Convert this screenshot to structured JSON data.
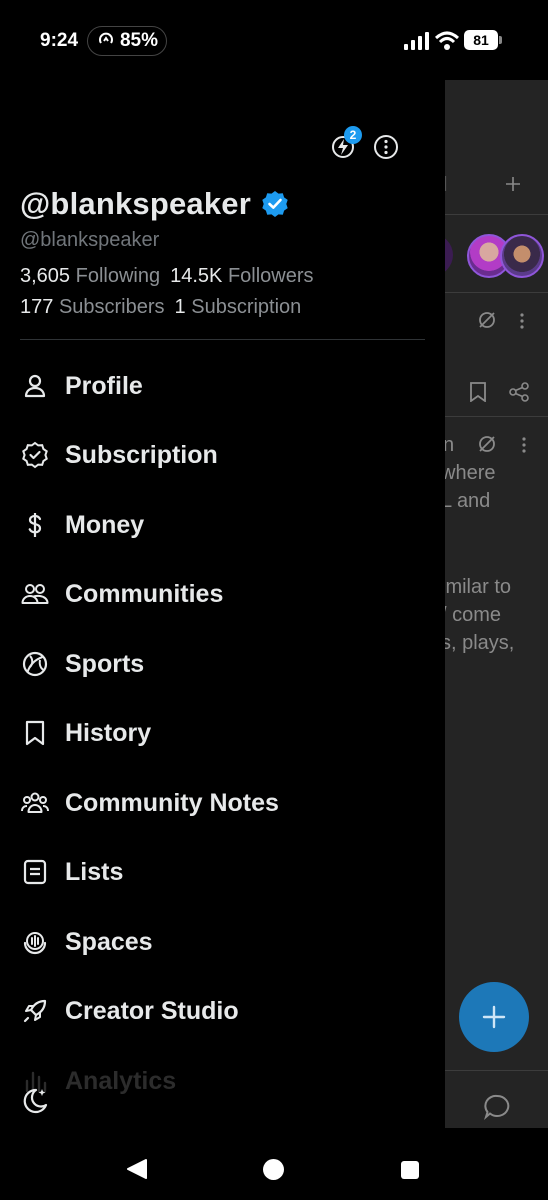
{
  "status_bar": {
    "time": "9:24",
    "hotspot_percent": "85%",
    "battery": "81",
    "icons": [
      "hotspot-icon",
      "signal-icon",
      "wifi-icon",
      "battery-icon"
    ]
  },
  "drawer": {
    "notification_badge": "2",
    "display_name": "@blankspeaker",
    "username": "@blankspeaker",
    "stats": {
      "following_count": "3,605",
      "following_label": "Following",
      "followers_count": "14.5K",
      "followers_label": "Followers",
      "subscribers_count": "177",
      "subscribers_label": "Subscribers",
      "subscription_count": "1",
      "subscription_label": "Subscription"
    },
    "menu": [
      {
        "label": "Profile",
        "icon": "person-icon"
      },
      {
        "label": "Subscription",
        "icon": "verified-badge-icon"
      },
      {
        "label": "Money",
        "icon": "dollar-icon"
      },
      {
        "label": "Communities",
        "icon": "people-icon"
      },
      {
        "label": "Sports",
        "icon": "ball-icon"
      },
      {
        "label": "History",
        "icon": "bookmark-icon"
      },
      {
        "label": "Community Notes",
        "icon": "group-icon"
      },
      {
        "label": "Lists",
        "icon": "list-icon"
      },
      {
        "label": "Spaces",
        "icon": "mic-icon"
      },
      {
        "label": "Creator Studio",
        "icon": "rocket-icon"
      },
      {
        "label": "Analytics",
        "icon": "bar-chart-icon"
      }
    ]
  },
  "feed_peek": {
    "text_lines": [
      "where",
      "L and",
      "imilar to",
      "/ come",
      "s, plays,"
    ],
    "header_char": "l",
    "inline_char": "n"
  },
  "colors": {
    "background": "#000000",
    "feed_overlay": "#242424",
    "accent": "#1d9bf0",
    "fab": "#1d78b8",
    "secondary_text": "#71767b"
  }
}
